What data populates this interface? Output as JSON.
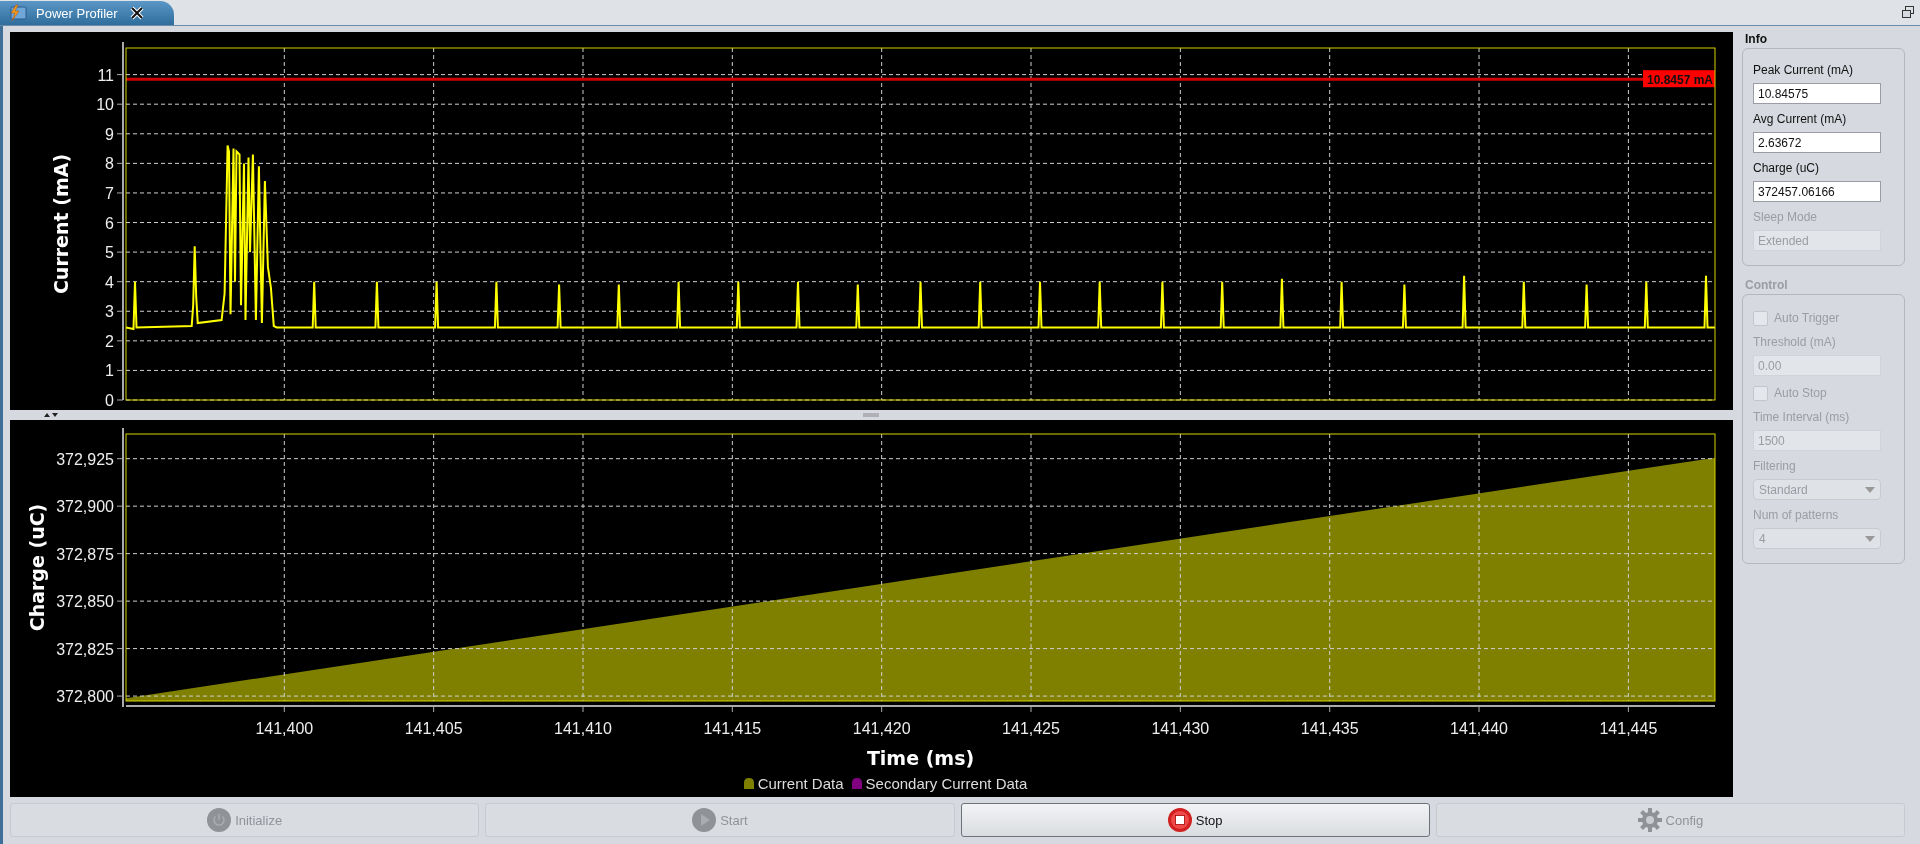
{
  "tabs": [
    {
      "label": "Power Profiler",
      "selected": true
    }
  ],
  "current_chart": {
    "chart_data": {
      "type": "line",
      "ylabel": "Current (mA)",
      "xlim": [
        141394.7,
        141447.9
      ],
      "ylim": [
        0,
        11.9
      ],
      "yticks": [
        0,
        1,
        2,
        3,
        4,
        5,
        6,
        7,
        8,
        9,
        10,
        11
      ],
      "x": [
        141394.7,
        141394.95,
        141395.0,
        141395.05,
        141396.9,
        141396.95,
        141397.0,
        141397.05,
        141397.1,
        141397.9,
        141398.0,
        141398.1,
        141398.15,
        141398.2,
        141398.3,
        141398.35,
        141398.4,
        141398.5,
        141398.55,
        141398.65,
        141398.7,
        141398.8,
        141398.85,
        141398.95,
        141399.05,
        141399.15,
        141399.25,
        141399.35,
        141399.45,
        141399.55,
        141399.65,
        141399.75,
        141400.95,
        141401.0,
        141401.05,
        141403.05,
        141403.1,
        141403.15,
        141405.05,
        141405.1,
        141405.15,
        141407.05,
        141407.1,
        141407.15,
        141409.15,
        141409.2,
        141409.25,
        141411.15,
        141411.2,
        141411.25,
        141413.15,
        141413.2,
        141413.25,
        141415.15,
        141415.2,
        141415.25,
        141417.15,
        141417.2,
        141417.25,
        141419.15,
        141419.2,
        141419.25,
        141421.25,
        141421.3,
        141421.35,
        141423.25,
        141423.3,
        141423.35,
        141425.25,
        141425.3,
        141425.35,
        141427.25,
        141427.3,
        141427.35,
        141429.35,
        141429.4,
        141429.45,
        141431.35,
        141431.4,
        141431.45,
        141433.35,
        141433.4,
        141433.45,
        141435.35,
        141435.4,
        141435.45,
        141437.45,
        141437.5,
        141437.55,
        141439.45,
        141439.5,
        141439.55,
        141441.45,
        141441.5,
        141441.55,
        141443.55,
        141443.6,
        141443.65,
        141445.55,
        141445.6,
        141445.65,
        141447.55,
        141447.6,
        141447.65,
        141447.9
      ],
      "series": [
        {
          "color": "#ffff00",
          "values": [
            2.45,
            2.4,
            4.0,
            2.45,
            2.5,
            3.2,
            5.2,
            3.5,
            2.6,
            2.7,
            3.6,
            8.6,
            8.4,
            2.9,
            8.5,
            4.0,
            8.4,
            8.3,
            3.2,
            8.0,
            2.7,
            8.2,
            5.0,
            8.3,
            2.7,
            7.9,
            2.6,
            7.4,
            4.5,
            3.8,
            2.5,
            2.45,
            2.45,
            4.0,
            2.45,
            2.45,
            4.0,
            2.45,
            2.45,
            4.0,
            2.45,
            2.45,
            4.0,
            2.45,
            2.45,
            3.9,
            2.45,
            2.45,
            3.9,
            2.45,
            2.45,
            4.0,
            2.45,
            2.45,
            4.0,
            2.45,
            2.45,
            4.0,
            2.45,
            2.45,
            3.9,
            2.45,
            2.45,
            4.0,
            2.45,
            2.45,
            4.0,
            2.45,
            2.45,
            4.0,
            2.45,
            2.45,
            4.0,
            2.45,
            2.45,
            4.0,
            2.45,
            2.45,
            4.0,
            2.45,
            2.45,
            4.1,
            2.45,
            2.45,
            4.0,
            2.45,
            2.45,
            3.9,
            2.45,
            2.45,
            4.2,
            2.45,
            2.45,
            4.0,
            2.45,
            2.45,
            3.9,
            2.45,
            2.45,
            4.0,
            2.45,
            2.45,
            4.2,
            2.45,
            2.45
          ]
        }
      ],
      "grid": true,
      "ref_lines": [
        {
          "axis": "y",
          "value": 10.8457,
          "label": "10.8457 mA"
        }
      ]
    }
  },
  "charge_chart": {
    "chart_data": {
      "type": "area",
      "xlabel": "Time (ms)",
      "ylabel": "Charge (uC)",
      "xlim": [
        141394.7,
        141447.9
      ],
      "ylim": [
        372797.4,
        372938
      ],
      "xticks": [
        {
          "value": 141400,
          "label": "141,400"
        },
        {
          "value": 141405,
          "label": "141,405"
        },
        {
          "value": 141410,
          "label": "141,410"
        },
        {
          "value": 141415,
          "label": "141,415"
        },
        {
          "value": 141420,
          "label": "141,420"
        },
        {
          "value": 141425,
          "label": "141,425"
        },
        {
          "value": 141430,
          "label": "141,430"
        },
        {
          "value": 141435,
          "label": "141,435"
        },
        {
          "value": 141440,
          "label": "141,440"
        },
        {
          "value": 141445,
          "label": "141,445"
        }
      ],
      "yticks": [
        {
          "value": 372800,
          "label": "372,800"
        },
        {
          "value": 372825,
          "label": "372,825"
        },
        {
          "value": 372850,
          "label": "372,850"
        },
        {
          "value": 372875,
          "label": "372,875"
        },
        {
          "value": 372900,
          "label": "372,900"
        },
        {
          "value": 372925,
          "label": "372,925"
        }
      ],
      "x": [
        141394.7,
        141447.9
      ],
      "grid": true,
      "series": [
        {
          "name": "Current Data",
          "color": "#808000",
          "values": [
            372798.8,
            372925.5
          ]
        }
      ]
    }
  },
  "legend": [
    {
      "label": "Secondary Current Data",
      "color": "#800080"
    }
  ],
  "info": {
    "title": "Info",
    "fields": [
      {
        "label": "Peak Current (mA)",
        "value": "10.84575",
        "disabled": false
      },
      {
        "label": "Avg Current (mA)",
        "value": "2.63672",
        "disabled": false
      },
      {
        "label": "Charge (uC)",
        "value": "372457.06166",
        "disabled": false
      },
      {
        "label": "Sleep Mode",
        "value": "Extended",
        "disabled": true
      }
    ]
  },
  "control": {
    "title": "Control",
    "disabled": true,
    "items": [
      {
        "kind": "checkbox",
        "label": "Auto Trigger",
        "checked": false,
        "disabled": true
      },
      {
        "kind": "text",
        "label": "Threshold (mA)",
        "value": "0.00",
        "disabled": true
      },
      {
        "kind": "checkbox",
        "label": "Auto Stop",
        "checked": false,
        "disabled": true
      },
      {
        "kind": "text",
        "label": "Time Interval (ms)",
        "value": "1500",
        "disabled": true
      },
      {
        "kind": "select",
        "label": "Filtering",
        "value": "Standard",
        "disabled": true
      },
      {
        "kind": "select",
        "label": "Num of patterns",
        "value": "4",
        "disabled": true
      }
    ]
  },
  "buttons": [
    {
      "kind": "initialize",
      "label": "Initialize",
      "disabled": true
    },
    {
      "kind": "start",
      "label": "Start",
      "disabled": true
    },
    {
      "kind": "stop",
      "label": "Stop",
      "disabled": false
    },
    {
      "kind": "config",
      "label": "Config",
      "disabled": true
    }
  ]
}
